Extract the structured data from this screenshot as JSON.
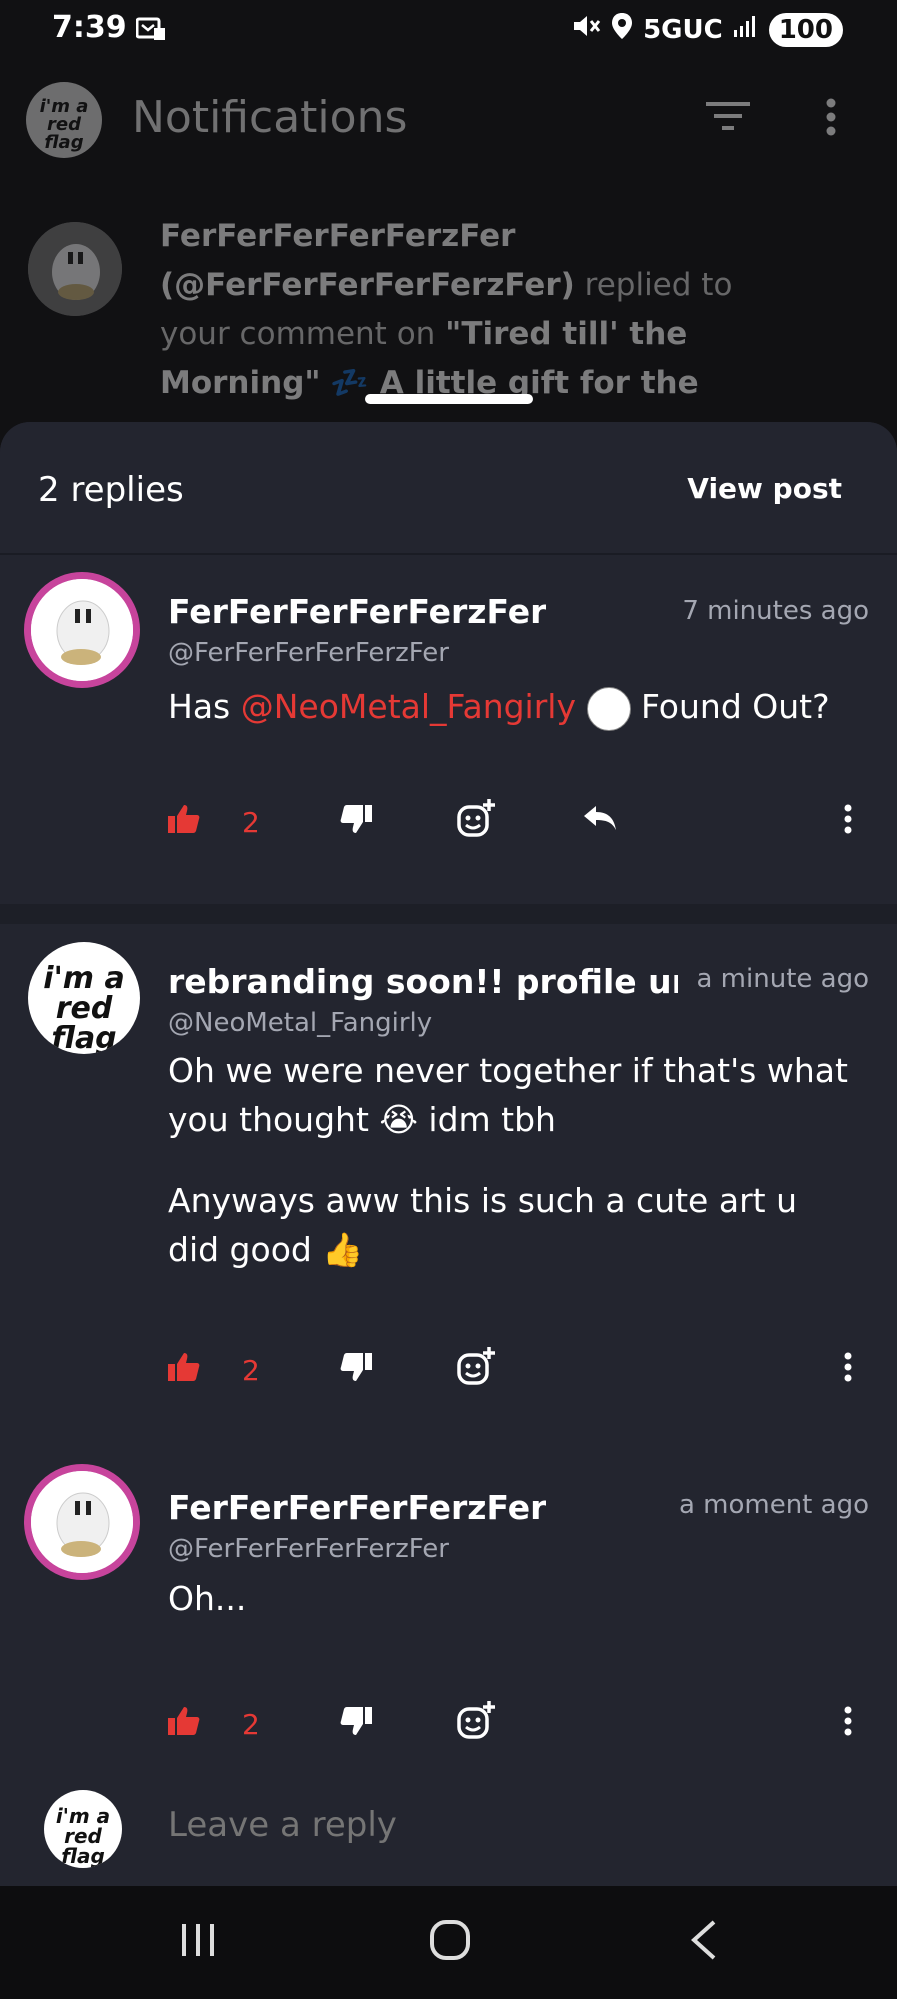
{
  "status_bar": {
    "time": "7:39",
    "network": "5GUC",
    "battery": "100"
  },
  "app_bar": {
    "title": "Notifications"
  },
  "notification": {
    "user_name": "FerFerFerFerFerzFer",
    "user_handle": "(@FerFerFerFerFerzFer)",
    "action_text": "replied to your comment on",
    "post_title": "\"Tired till' the Morning\"",
    "post_suffix": "💤 A little gift for the"
  },
  "sheet": {
    "replies_count": "2 replies",
    "view_post_label": "View post"
  },
  "comments": [
    {
      "name": "FerFerFerFerFerzFer",
      "handle": "@FerFerFerFerFerzFer",
      "time": "7 minutes ago",
      "body_prefix": "Has ",
      "mention": "@NeoMetal_Fangirly",
      "body_suffix": " Found Out?",
      "likes": "2"
    },
    {
      "name": "rebranding soon!! profile unde",
      "handle": "@NeoMetal_Fangirly",
      "time": "a minute ago",
      "paragraph_1": "Oh we were never together if that's what you thought 😭 idm tbh",
      "paragraph_2": "Anyways aww this is such a cute art u did good 👍",
      "likes": "2"
    },
    {
      "name": "FerFerFerFerFerzFer",
      "handle": "@FerFerFerFerFerzFer",
      "time": "a moment ago",
      "body": "Oh...",
      "likes": "2"
    }
  ],
  "reply_input": {
    "placeholder": "Leave a reply"
  },
  "avatar_art": {
    "red_flag_line_1": "i'm a",
    "red_flag_line_2": "red flag"
  },
  "colors": {
    "accent_red": "#e53935",
    "sheet_bg": "#23252f",
    "avatar_ring": "#c7449c"
  }
}
